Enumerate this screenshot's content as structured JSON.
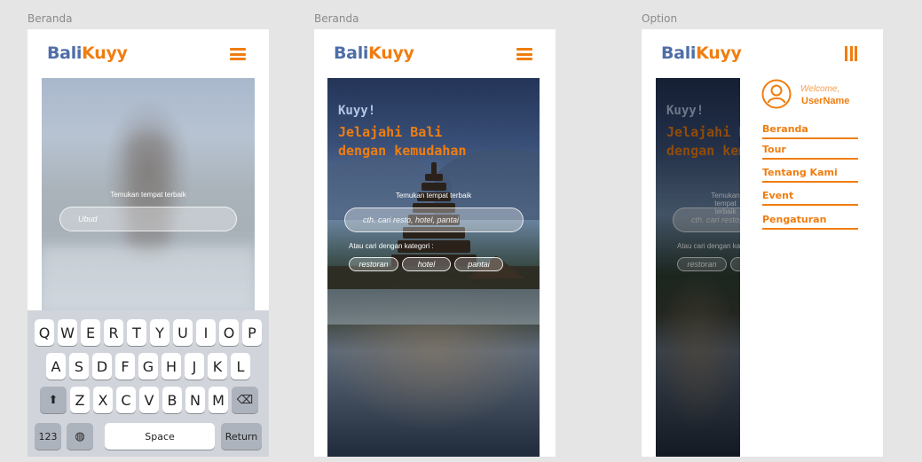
{
  "frames": [
    {
      "label": "Beranda"
    },
    {
      "label": "Beranda"
    },
    {
      "label": "Option"
    }
  ],
  "logo": {
    "part1": "Bali",
    "part2": "Kuyy"
  },
  "search": {
    "label": "Temukan tempat terbaik",
    "typed_value": "Ubud",
    "placeholder": "cth. cari resto, hotel, pantai"
  },
  "hero": {
    "kuyy": "Kuyy!",
    "line1": "Jelajahi Bali",
    "line2": "dengan kemudahan"
  },
  "category": {
    "label": "Atau cari dengan kategori :",
    "chips": [
      "restoran",
      "hotel",
      "pantai"
    ]
  },
  "keyboard": {
    "row1": [
      "Q",
      "W",
      "E",
      "R",
      "T",
      "Y",
      "U",
      "I",
      "O",
      "P"
    ],
    "row2": [
      "A",
      "S",
      "D",
      "F",
      "G",
      "H",
      "J",
      "K",
      "L"
    ],
    "row3": [
      "Z",
      "X",
      "C",
      "V",
      "B",
      "N",
      "M"
    ],
    "shift": "⬆",
    "backspace": "⌫",
    "numbers": "123",
    "globe": "◍",
    "space": "Space",
    "return": "Return"
  },
  "menu": {
    "welcome": "Welcome,",
    "username": "UserName",
    "items": [
      "Beranda",
      "Tour",
      "Tentang Kami",
      "Event",
      "Pengaturan"
    ]
  },
  "colors": {
    "accent": "#f07d10",
    "brand_blue": "#4f6ea8"
  }
}
